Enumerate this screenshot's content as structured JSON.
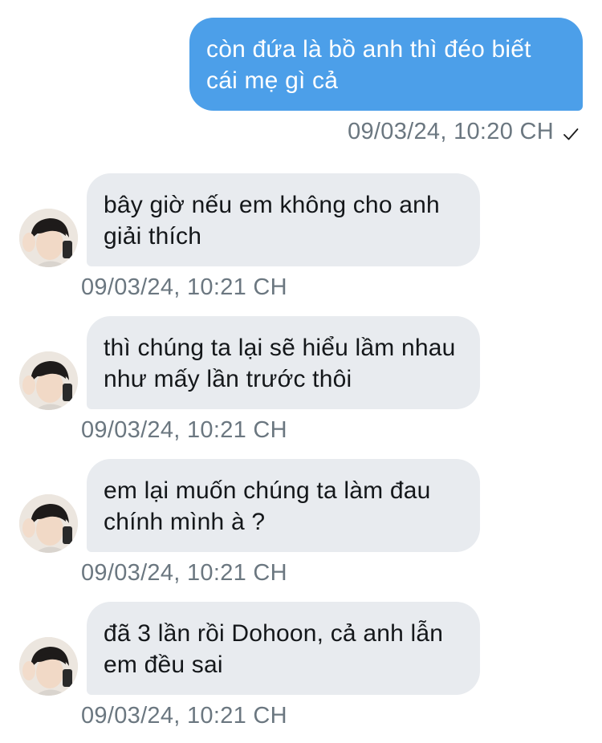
{
  "sent_message": {
    "text": "còn đứa là bồ anh thì đéo biết cái mẹ gì cả",
    "timestamp": "09/03/24, 10:20 CH",
    "status_icon": "check-icon",
    "bubble_color": "#4c9fe9"
  },
  "received_messages": [
    {
      "text": "bây giờ nếu em không cho anh giải thích",
      "timestamp": "09/03/24, 10:21 CH"
    },
    {
      "text": "thì chúng ta lại sẽ hiểu lầm nhau như mấy lần trước thôi",
      "timestamp": "09/03/24, 10:21 CH"
    },
    {
      "text": "em lại muốn chúng ta làm đau chính mình à ?",
      "timestamp": "09/03/24, 10:21 CH"
    },
    {
      "text": "đã 3 lần rồi Dohoon, cả anh lẫn em đều sai",
      "timestamp": "09/03/24, 10:21 CH"
    }
  ],
  "colors": {
    "received_bubble": "#e8ebef",
    "timestamp_text": "#6b7780"
  }
}
